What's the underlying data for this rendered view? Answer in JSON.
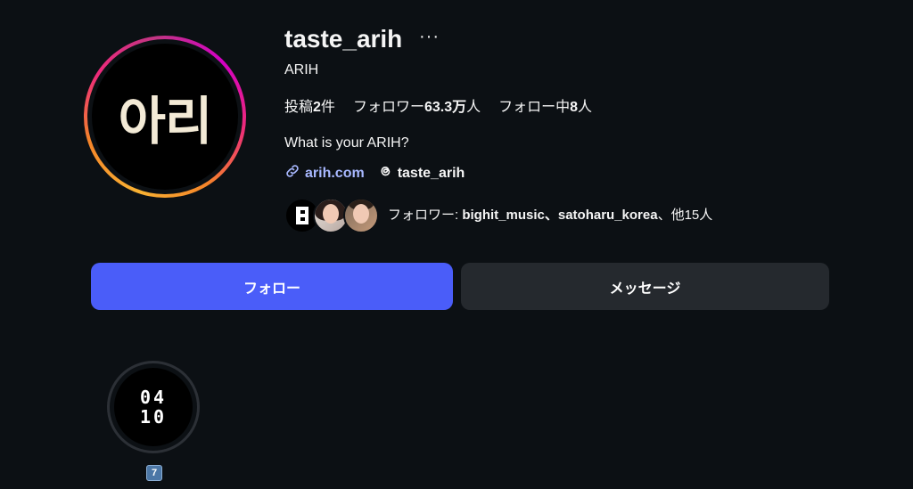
{
  "profile": {
    "avatar_text": "아리",
    "username": "taste_arih",
    "more_icon": "···",
    "full_name": "ARIH",
    "bio": "What is your ARIH?"
  },
  "stats": {
    "posts_label": "投稿",
    "posts_num": "2",
    "posts_unit": "件",
    "followers_label": "フォロワー",
    "followers_num": "63.3万",
    "followers_unit": "人",
    "following_label": "フォロー中",
    "following_num": "8",
    "following_unit": "人"
  },
  "links": {
    "link_icon": "link-icon",
    "url": "arih.com",
    "threads_icon": "threads-icon",
    "threads": "taste_arih"
  },
  "followed_by": {
    "prefix": "フォロワー: ",
    "names": "bighit_music、satoharu_korea",
    "suffix": "、他15人"
  },
  "buttons": {
    "follow": "フォロー",
    "message": "メッセージ"
  },
  "highlights": [
    {
      "line1": "04",
      "line2": "10",
      "label": "7"
    }
  ],
  "colors": {
    "background": "#0c1014",
    "follow_button": "#4a5df9",
    "message_button": "#25292e",
    "link": "#a8b8ff"
  }
}
